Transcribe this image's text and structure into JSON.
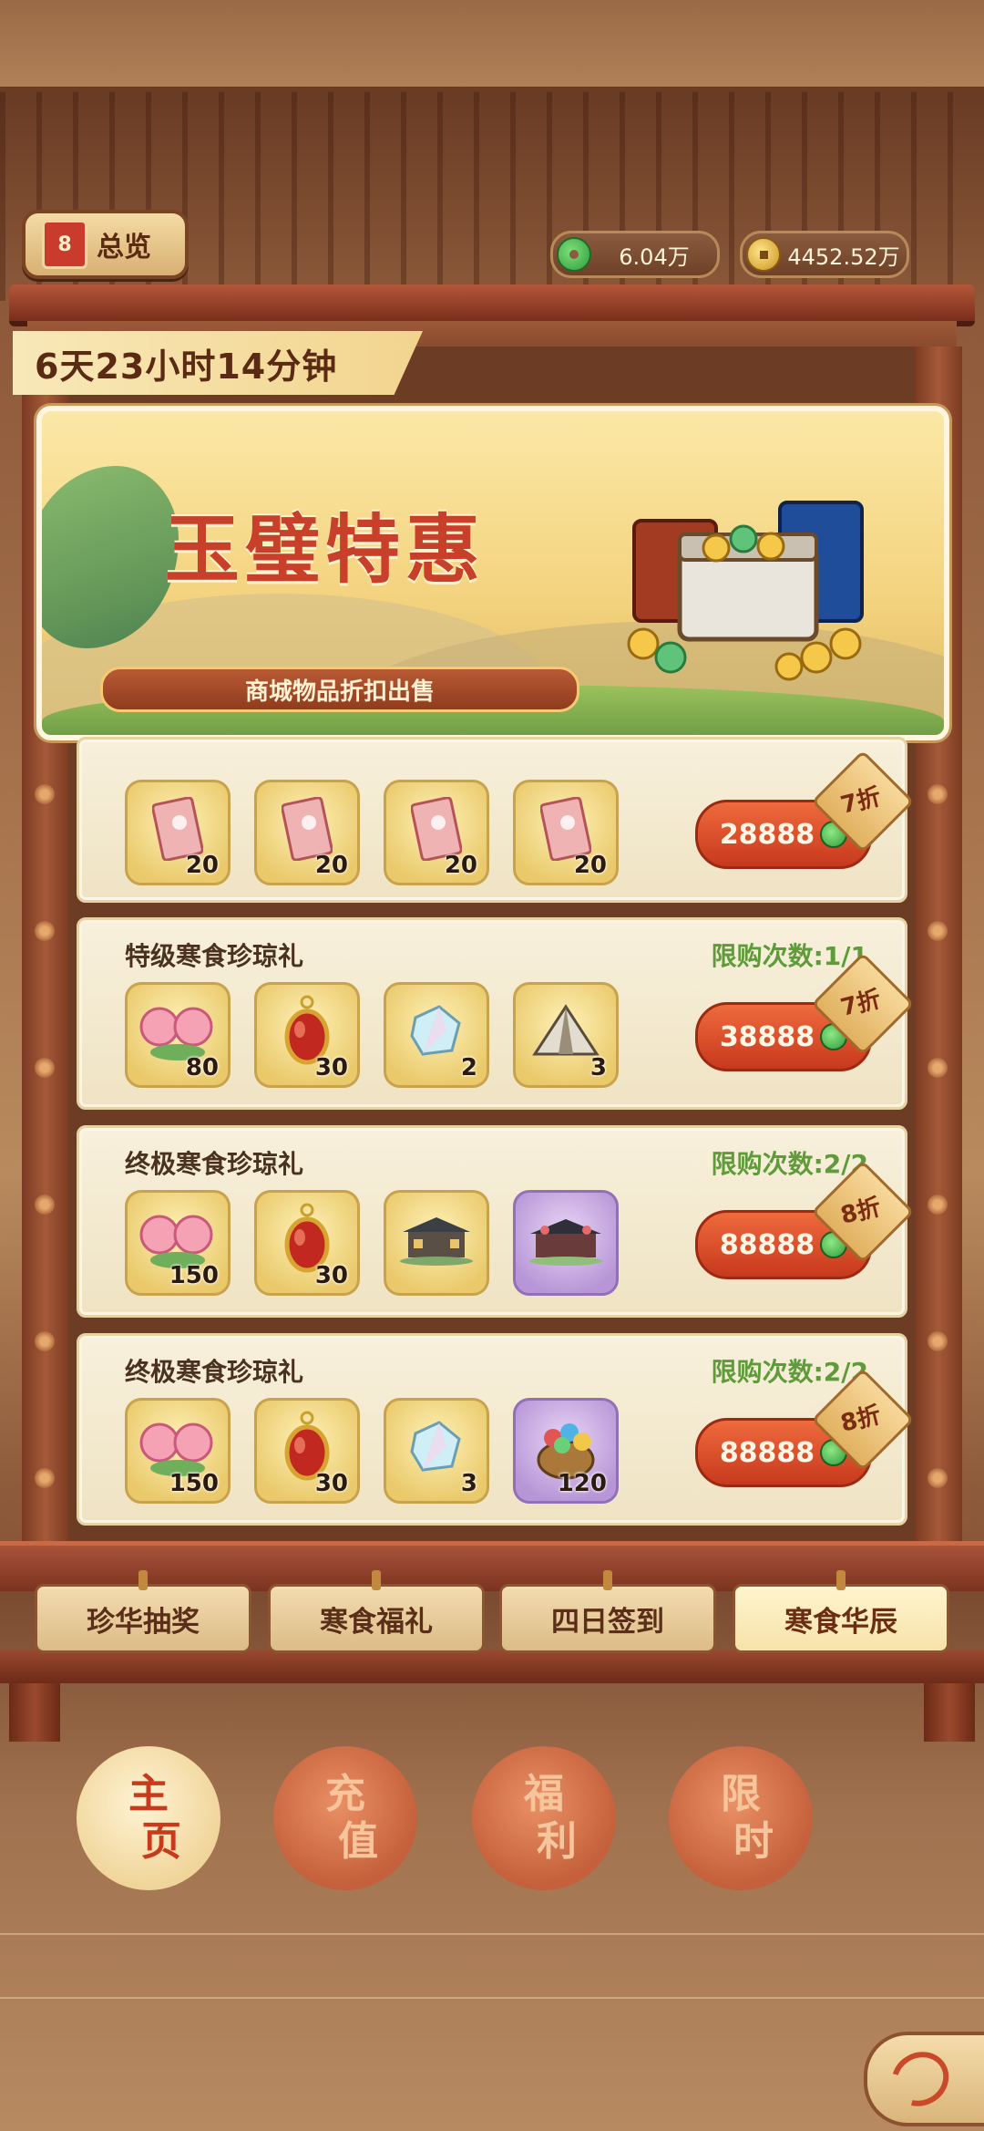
{
  "header": {
    "overview_label": "总览",
    "overview_icon_text": "8",
    "currency_jade": "6.04万",
    "currency_gold": "4452.52万"
  },
  "timer": "6天23小时14分钟",
  "banner": {
    "title": "玉璧特惠",
    "subtitle": "商城物品折扣出售"
  },
  "packs": [
    {
      "title": "",
      "limit": "",
      "price": "28888",
      "discount": "7折",
      "items": [
        {
          "icon": "red-envelope-icon",
          "qty": "20",
          "rarity": "gold"
        },
        {
          "icon": "red-envelope-icon",
          "qty": "20",
          "rarity": "gold"
        },
        {
          "icon": "red-envelope-icon",
          "qty": "20",
          "rarity": "gold"
        },
        {
          "icon": "red-envelope-icon",
          "qty": "20",
          "rarity": "gold"
        }
      ]
    },
    {
      "title": "特级寒食珍琼礼",
      "limit": "限购次数:1/1",
      "price": "38888",
      "discount": "7折",
      "items": [
        {
          "icon": "peony-flower-icon",
          "qty": "80",
          "rarity": "gold"
        },
        {
          "icon": "red-gem-pendant-icon",
          "qty": "30",
          "rarity": "gold"
        },
        {
          "icon": "crystal-icon",
          "qty": "2",
          "rarity": "gold"
        },
        {
          "icon": "tent-icon",
          "qty": "3",
          "rarity": "gold"
        }
      ]
    },
    {
      "title": "终极寒食珍琼礼",
      "limit": "限购次数:2/2",
      "price": "88888",
      "discount": "8折",
      "items": [
        {
          "icon": "peony-flower-icon",
          "qty": "150",
          "rarity": "gold"
        },
        {
          "icon": "red-gem-pendant-icon",
          "qty": "30",
          "rarity": "gold"
        },
        {
          "icon": "mansion-icon",
          "qty": "",
          "rarity": "gold"
        },
        {
          "icon": "palace-icon",
          "qty": "",
          "rarity": "purple"
        }
      ]
    },
    {
      "title": "终极寒食珍琼礼",
      "limit": "限购次数:2/2",
      "price": "88888",
      "discount": "8折",
      "items": [
        {
          "icon": "peony-flower-icon",
          "qty": "150",
          "rarity": "gold"
        },
        {
          "icon": "red-gem-pendant-icon",
          "qty": "30",
          "rarity": "gold"
        },
        {
          "icon": "crystal-icon",
          "qty": "3",
          "rarity": "gold"
        },
        {
          "icon": "gem-pot-icon",
          "qty": "120",
          "rarity": "purple"
        }
      ]
    }
  ],
  "tabs": [
    {
      "label": "珍华抽奖",
      "active": false
    },
    {
      "label": "寒食福礼",
      "active": false
    },
    {
      "label": "四日签到",
      "active": false
    },
    {
      "label": "寒食华辰",
      "active": true
    }
  ],
  "bottom_nav": [
    {
      "top": "主",
      "bottom": "页",
      "active": true
    },
    {
      "top": "充",
      "bottom": "值",
      "active": false
    },
    {
      "top": "福",
      "bottom": "利",
      "active": false
    },
    {
      "top": "限",
      "bottom": "时",
      "active": false
    }
  ],
  "colors": {
    "price_button": "#d9482a",
    "limit_text": "#5f9b3a",
    "banner_title": "#c8402a"
  }
}
